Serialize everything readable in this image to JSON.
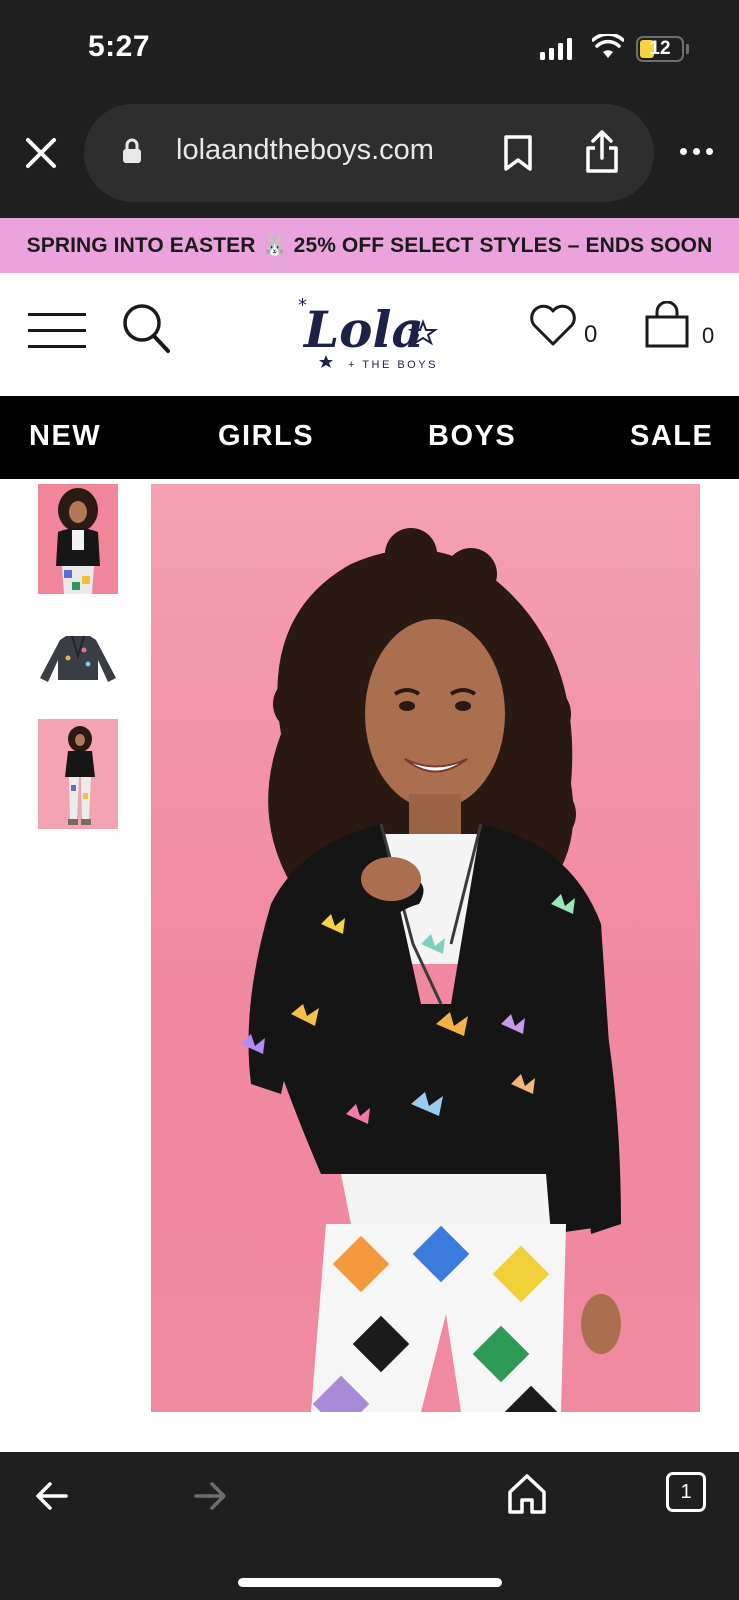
{
  "status_bar": {
    "time": "5:27",
    "battery": "12"
  },
  "browser": {
    "url": "lolaandtheboys.com",
    "tab_count": "1"
  },
  "promo": {
    "text": "SPRING INTO EASTER 🐰 25% OFF SELECT STYLES – ENDS SOON"
  },
  "header": {
    "logo": {
      "script": "Lola",
      "tagline": "+ THE BOYS"
    },
    "wishlist_count": "0",
    "cart_count": "0"
  },
  "nav": {
    "items": [
      "NEW",
      "GIRLS",
      "BOYS",
      "SALE"
    ]
  },
  "colors": {
    "promo_bg": "#eaa3dc",
    "nav_bg": "#000000",
    "chrome_bg": "#1f1f1f",
    "photo_bg": "#f0889f"
  },
  "icons": [
    "close-icon",
    "lock-icon",
    "bookmark-icon",
    "share-icon",
    "more-icon",
    "menu-icon",
    "search-icon",
    "heart-icon",
    "bag-icon",
    "back-arrow-icon",
    "forward-arrow-icon",
    "home-icon",
    "tabs-icon"
  ]
}
